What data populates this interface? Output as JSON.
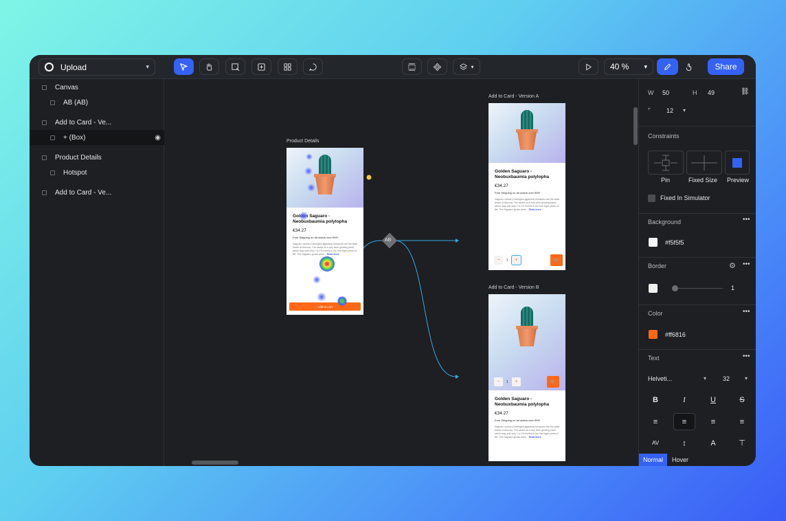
{
  "app": {
    "project_name": "Upload",
    "share_label": "Share",
    "zoom_value": "40 %"
  },
  "layers": [
    {
      "label": "Canvas",
      "depth": 0
    },
    {
      "label": "AB (AB)",
      "depth": 1
    },
    {
      "label": "Add to Card - Ve...",
      "depth": 0
    },
    {
      "label": "+ (Box)",
      "depth": 1,
      "selected": true
    },
    {
      "label": "Product Details",
      "depth": 0
    },
    {
      "label": "Hotspot",
      "depth": 1
    },
    {
      "label": "Add to Card - Ve...",
      "depth": 0
    }
  ],
  "canvas": {
    "frames": {
      "product_details": {
        "label": "Product Details",
        "title": "Golden Saguaro - Neobuxbaumia polylopha",
        "price": "€34.27",
        "shipping": "Free Shipping on all orders over €99*",
        "description": "Saguaro cactus (Carnegiea gigantea) blossoms are the state flower of Arizona. The cactus is a very slow growing plant, which may add only 1 to 1½ inches in the first eight years of life. The Saguaro grows arms...",
        "read_more": "Read more",
        "button": "Add to cart"
      },
      "version_a": {
        "label": "Add to Card - Version A",
        "title": "Golden Saguaro - Neobuxbaumia polylopha",
        "price": "€34.27",
        "shipping": "Free Shipping on all orders over €99*",
        "description": "Saguaro cactus (Carnegiea gigantea) blossoms are the state flower of Arizona. The cactus is a very slow growing plant, which may add only 1 to 1½ inches in the first eight years of life. The Saguaro grows arms...",
        "read_more": "Read more",
        "qty_minus": "−",
        "qty_value": "1",
        "qty_plus": "+"
      },
      "version_b": {
        "label": "Add to Card - Version B",
        "title": "Golden Saguaro - Neobuxbaumia polylopha",
        "price": "€34.27",
        "shipping": "Free Shipping on all orders over €99*",
        "description": "Saguaro cactus (Carnegiea gigantea) blossoms are the state flower of Arizona. The cactus is a very slow growing plant, which may add only 1 to 1½ inches in the first eight years of life. The Saguaro grows arms...",
        "read_more": "Read more",
        "qty_minus": "−",
        "qty_value": "1",
        "qty_plus": "+"
      }
    },
    "ab_node_label": "AB"
  },
  "inspector": {
    "w_label": "W",
    "w_value": "50",
    "h_label": "H",
    "h_value": "49",
    "radius_value": "12",
    "constraints_title": "Constraints",
    "constraint_options": [
      "Pin",
      "Fixed Size",
      "Preview"
    ],
    "fixed_in_simulator": "Fixed In Simulator",
    "background_title": "Background",
    "background_value": "#f5f5f5",
    "border_title": "Border",
    "border_value": "1",
    "color_title": "Color",
    "color_value": "#ff6816",
    "text_title": "Text",
    "font_name": "Helveti...",
    "font_size": "32",
    "state_tabs": [
      "Normal",
      "Hover"
    ]
  },
  "colors": {
    "accent": "#3462f5",
    "orange": "#ff6816",
    "background_swatch": "#f5f5f5",
    "border_swatch": "#f0f0f0",
    "hotspot": "#f5c542",
    "connector": "#3aa8e8"
  }
}
